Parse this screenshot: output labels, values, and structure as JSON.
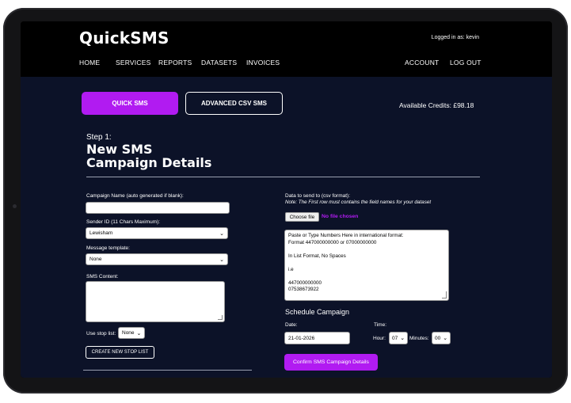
{
  "brand": {
    "logo": "QuickSMS"
  },
  "header": {
    "logged_in": "Logged in as: kevin"
  },
  "nav": {
    "home": "HOME",
    "services": "SERVICES",
    "reports": "REPORTS",
    "datasets": "DATASETS",
    "invoices": "INVOICES",
    "account": "ACCOUNT",
    "logout": "LOG OUT"
  },
  "tabs": {
    "quick": "QUICK SMS",
    "advanced": "ADVANCED CSV SMS"
  },
  "credits": "Available Credits: £98.18",
  "step": {
    "label": "Step 1:",
    "title_line1": "New SMS",
    "title_line2": "Campaign Details"
  },
  "form": {
    "campaign_name_label": "Campaign Name (auto generated if blank):",
    "campaign_name_value": "",
    "sender_label": "Sender ID (11 Chars Maximum):",
    "sender_value": "Lewisham",
    "template_label": "Message template:",
    "template_value": "None",
    "content_label": "SMS Content:",
    "stop_list_label": "Use stop list:",
    "stop_list_value": "None",
    "create_stop_button": "CREATE NEW STOP LIST"
  },
  "data_section": {
    "label": "Data to send to (csv format):",
    "note": "Note: The First row must contains the field names for your dataset",
    "choose_file": "Choose file",
    "no_file": "No file chosen",
    "textarea_lines": [
      "Paste or Type Numbers Here in international format:",
      "Format 447000000000 or 07000000000",
      "",
      "In List Format, No Spaces",
      "",
      "i.e",
      "",
      "447000000000",
      "07538673922"
    ]
  },
  "schedule": {
    "title": "Schedule Campaign",
    "date_label": "Date:",
    "date_value": "21-01-2026",
    "time_label": "Time:",
    "hour_label": "Hour:",
    "hour_value": "07",
    "minutes_label": "Minutes:",
    "minutes_value": "00",
    "confirm_button": "Confirm SMS Campaign Details"
  },
  "colors": {
    "accent": "#b11bf1",
    "background": "#0c1228",
    "header": "#000000",
    "text": "#ffffff"
  },
  "icons": {
    "select_arrow": "chevron-down-icon"
  }
}
